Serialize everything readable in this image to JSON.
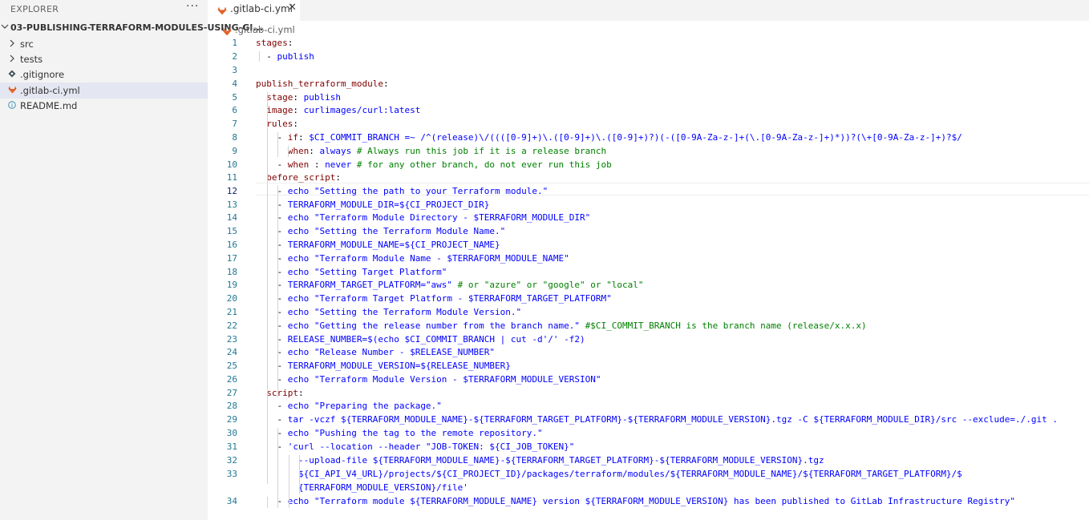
{
  "explorer": {
    "title": "EXPLORER",
    "more_icon": "···",
    "root_folder": "03-PUBLISHING-TERRAFORM-MODULES-USING-GI...",
    "items": [
      {
        "label": "src",
        "icon": "chevron-right"
      },
      {
        "label": "tests",
        "icon": "chevron-right"
      },
      {
        "label": ".gitignore",
        "icon": "git-diamond"
      },
      {
        "label": ".gitlab-ci.yml",
        "icon": "gitlab"
      },
      {
        "label": "README.md",
        "icon": "info"
      }
    ]
  },
  "tab": {
    "label": ".gitlab-ci.yml",
    "close": "✕"
  },
  "breadcrumb": ".gitlab-ci.yml",
  "colors": {
    "key": "#800000",
    "string": "#0000ff",
    "comment": "#008000",
    "line_number": "#237893",
    "gitlab": "#e2632a"
  },
  "editor": {
    "active_line": 12,
    "line_numbers": [
      "1",
      "2",
      "3",
      "4",
      "5",
      "6",
      "7",
      "8",
      "9",
      "10",
      "11",
      "12",
      "13",
      "14",
      "15",
      "16",
      "17",
      "18",
      "19",
      "20",
      "21",
      "22",
      "23",
      "24",
      "25",
      "26",
      "27",
      "28",
      "29",
      "30",
      "31",
      "32",
      "33",
      "34"
    ],
    "lines": [
      [
        [
          "k",
          "stages"
        ],
        [
          "p",
          ":"
        ]
      ],
      [
        [
          "p",
          "  - "
        ],
        [
          "s",
          "publish"
        ]
      ],
      [],
      [
        [
          "k",
          "publish_terraform_module"
        ],
        [
          "p",
          ":"
        ]
      ],
      [
        [
          "p",
          "  "
        ],
        [
          "k",
          "stage"
        ],
        [
          "p",
          ": "
        ],
        [
          "s",
          "publish"
        ]
      ],
      [
        [
          "p",
          "  "
        ],
        [
          "k",
          "image"
        ],
        [
          "p",
          ": "
        ],
        [
          "s",
          "curlimages/curl:latest"
        ]
      ],
      [
        [
          "p",
          "  "
        ],
        [
          "k",
          "rules"
        ],
        [
          "p",
          ":"
        ]
      ],
      [
        [
          "p",
          "    - "
        ],
        [
          "k",
          "if"
        ],
        [
          "p",
          ": "
        ],
        [
          "s",
          "$CI_COMMIT_BRANCH =~ /^(release)\\/((([0-9]+)\\.([0-9]+)\\.([0-9]+)?)(-([0-9A-Za-z-]+(\\.[0-9A-Za-z-]+)*))?(\\+[0-9A-Za-z-]+)?$/"
        ]
      ],
      [
        [
          "p",
          "      "
        ],
        [
          "k",
          "when"
        ],
        [
          "p",
          ": "
        ],
        [
          "s",
          "always"
        ],
        [
          "c",
          " # Always run this job if it is a release branch"
        ]
      ],
      [
        [
          "p",
          "    - "
        ],
        [
          "k",
          "when"
        ],
        [
          "p",
          " : "
        ],
        [
          "s",
          "never"
        ],
        [
          "c",
          " # for any other branch, do not ever run this job"
        ]
      ],
      [
        [
          "p",
          "  "
        ],
        [
          "k",
          "before_script"
        ],
        [
          "p",
          ":"
        ]
      ],
      [
        [
          "p",
          "    - "
        ],
        [
          "s",
          "echo \"Setting the path to your Terraform module.\""
        ]
      ],
      [
        [
          "p",
          "    - "
        ],
        [
          "s",
          "TERRAFORM_MODULE_DIR=${CI_PROJECT_DIR}"
        ]
      ],
      [
        [
          "p",
          "    - "
        ],
        [
          "s",
          "echo \"Terraform Module Directory - $TERRAFORM_MODULE_DIR\""
        ]
      ],
      [
        [
          "p",
          "    - "
        ],
        [
          "s",
          "echo \"Setting the Terraform Module Name.\""
        ]
      ],
      [
        [
          "p",
          "    - "
        ],
        [
          "s",
          "TERRAFORM_MODULE_NAME=${CI_PROJECT_NAME}"
        ]
      ],
      [
        [
          "p",
          "    - "
        ],
        [
          "s",
          "echo \"Terraform Module Name - $TERRAFORM_MODULE_NAME\""
        ]
      ],
      [
        [
          "p",
          "    - "
        ],
        [
          "s",
          "echo \"Setting Target Platform\""
        ]
      ],
      [
        [
          "p",
          "    - "
        ],
        [
          "s",
          "TERRAFORM_TARGET_PLATFORM=\"aws\""
        ],
        [
          "c",
          " # or \"azure\" or \"google\" or \"local\""
        ]
      ],
      [
        [
          "p",
          "    - "
        ],
        [
          "s",
          "echo \"Terraform Target Platform - $TERRAFORM_TARGET_PLATFORM\""
        ]
      ],
      [
        [
          "p",
          "    - "
        ],
        [
          "s",
          "echo \"Setting the Terraform Module Version.\""
        ]
      ],
      [
        [
          "p",
          "    - "
        ],
        [
          "s",
          "echo \"Getting the release number from the branch name.\""
        ],
        [
          "c",
          " #$CI_COMMIT_BRANCH is the branch name (release/x.x.x)"
        ]
      ],
      [
        [
          "p",
          "    - "
        ],
        [
          "s",
          "RELEASE_NUMBER=$(echo $CI_COMMIT_BRANCH | cut -d'/' -f2)"
        ]
      ],
      [
        [
          "p",
          "    - "
        ],
        [
          "s",
          "echo \"Release Number - $RELEASE_NUMBER\""
        ]
      ],
      [
        [
          "p",
          "    - "
        ],
        [
          "s",
          "TERRAFORM_MODULE_VERSION=${RELEASE_NUMBER}"
        ]
      ],
      [
        [
          "p",
          "    - "
        ],
        [
          "s",
          "echo \"Terraform Module Version - $TERRAFORM_MODULE_VERSION\""
        ]
      ],
      [
        [
          "p",
          "  "
        ],
        [
          "k",
          "script"
        ],
        [
          "p",
          ":"
        ]
      ],
      [
        [
          "p",
          "    - "
        ],
        [
          "s",
          "echo \"Preparing the package.\""
        ]
      ],
      [
        [
          "p",
          "    - "
        ],
        [
          "s",
          "tar -vczf ${TERRAFORM_MODULE_NAME}-${TERRAFORM_TARGET_PLATFORM}-${TERRAFORM_MODULE_VERSION}.tgz -C ${TERRAFORM_MODULE_DIR}/src --exclude=./.git ."
        ]
      ],
      [
        [
          "p",
          "    - "
        ],
        [
          "s",
          "echo \"Pushing the tag to the remote repository.\""
        ]
      ],
      [
        [
          "p",
          "    - "
        ],
        [
          "s",
          "'curl --location --header \"JOB-TOKEN: ${CI_JOB_TOKEN}\""
        ]
      ],
      [
        [
          "p",
          "        "
        ],
        [
          "s",
          "--upload-file ${TERRAFORM_MODULE_NAME}-${TERRAFORM_TARGET_PLATFORM}-${TERRAFORM_MODULE_VERSION}.tgz"
        ]
      ],
      [
        [
          "p",
          "        "
        ],
        [
          "s",
          "${CI_API_V4_URL}/projects/${CI_PROJECT_ID}/packages/terraform/modules/${TERRAFORM_MODULE_NAME}/${TERRAFORM_TARGET_PLATFORM}/$"
        ]
      ],
      [
        [
          "p",
          "        "
        ],
        [
          "s",
          "{TERRAFORM_MODULE_VERSION}/file'"
        ]
      ],
      [
        [
          "p",
          "    - "
        ],
        [
          "s",
          "echo \"Terraform module ${TERRAFORM_MODULE_NAME} version ${TERRAFORM_MODULE_VERSION} has been published to GitLab Infrastructure Registry\""
        ]
      ]
    ]
  }
}
